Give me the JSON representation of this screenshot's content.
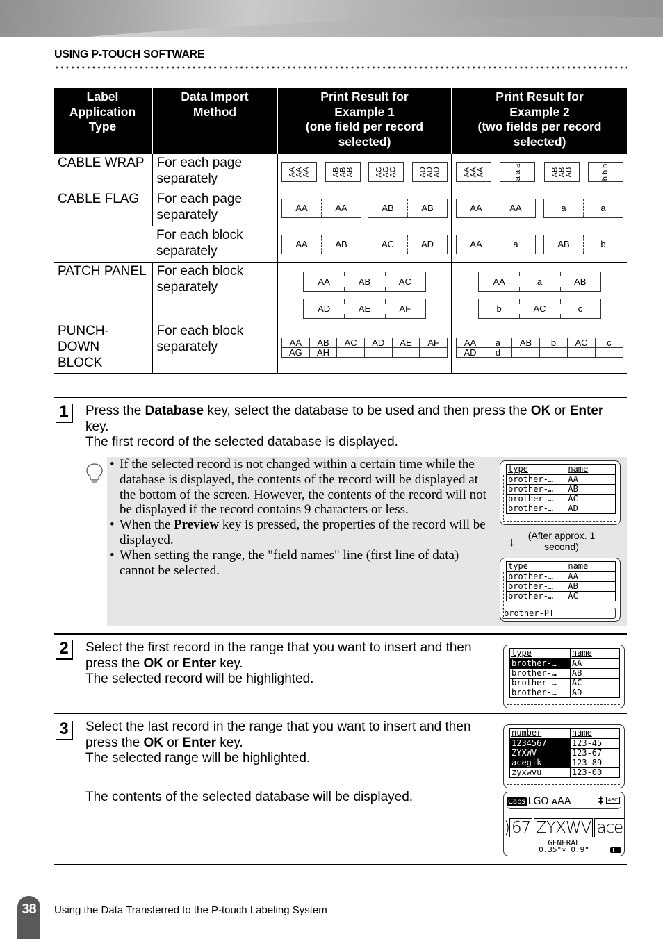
{
  "header": {
    "section_title": "USING P-TOUCH SOFTWARE"
  },
  "table": {
    "headers": [
      "Label Application Type",
      "Data Import Method",
      "Print Result for Example 1 (one field per record selected)",
      "Print Result for Example 2 (two fields per record selected)"
    ],
    "header_lines": [
      [
        "Label",
        "Application",
        "Type"
      ],
      [
        "Data Import",
        "Method"
      ],
      [
        "Print Result for",
        "Example 1",
        "(one field per record",
        "selected)"
      ],
      [
        "Print Result for",
        "Example 2",
        "(two fields per record",
        "selected)"
      ]
    ],
    "rows": {
      "cable_wrap": {
        "type": "CABLE WRAP",
        "method": "For each page separately",
        "ex1": [
          "AA\nAA\nAA",
          "AB\nAB\nAB",
          "AC\nAC\nAC",
          "AD\nAD\nAD"
        ],
        "ex2": [
          "AA\nAA\nAA",
          "a a a",
          "AB\nAB\nAB",
          "b b b"
        ]
      },
      "cable_flag_page": {
        "type": "CABLE FLAG",
        "method": "For each page separately",
        "ex1": [
          [
            "AA",
            "AA"
          ],
          [
            "AB",
            "AB"
          ]
        ],
        "ex2": [
          [
            "AA",
            "AA"
          ],
          [
            "a",
            "a"
          ]
        ]
      },
      "cable_flag_block": {
        "method": "For each block separately",
        "ex1": [
          [
            "AA",
            "AB"
          ],
          [
            "AC",
            "AD"
          ]
        ],
        "ex2": [
          [
            "AA",
            "a"
          ],
          [
            "AB",
            "b"
          ]
        ]
      },
      "patch_panel": {
        "type": "PATCH PANEL",
        "method": "For each block separately",
        "ex1": [
          [
            "AA",
            "AB",
            "AC"
          ],
          [
            "AD",
            "AE",
            "AF"
          ]
        ],
        "ex2": [
          [
            "AA",
            "a",
            "AB"
          ],
          [
            "b",
            "AC",
            "c"
          ]
        ]
      },
      "punch_down": {
        "type": "PUNCH- DOWN BLOCK",
        "type_lines": [
          "PUNCH-",
          "DOWN",
          "BLOCK"
        ],
        "method": "For each block separately",
        "ex1": [
          [
            "AA",
            "AB",
            "AC",
            "AD",
            "AE",
            "AF"
          ],
          [
            "AG",
            "AH",
            "",
            "",
            "",
            ""
          ]
        ],
        "ex2": [
          [
            "AA",
            "a",
            "AB",
            "b",
            "AC",
            "c"
          ],
          [
            "AD",
            "d",
            "",
            "",
            "",
            ""
          ]
        ]
      }
    }
  },
  "steps": [
    {
      "number": "1",
      "parts": [
        {
          "t": "Press the "
        },
        {
          "b": "Database"
        },
        {
          "t": " key, select the database to be used and then press the "
        },
        {
          "b": "OK"
        },
        {
          "t": " or "
        },
        {
          "b": "Enter"
        },
        {
          "t": " key."
        }
      ],
      "line2": "The first record of the selected database is displayed."
    },
    {
      "number": "2",
      "parts": [
        {
          "t": "Select the first record in the range that you want to insert and then press the "
        },
        {
          "b": "OK"
        },
        {
          "t": " or "
        },
        {
          "b": "Enter"
        },
        {
          "t": " key."
        }
      ],
      "line2": "The selected record will be highlighted."
    },
    {
      "number": "3",
      "parts": [
        {
          "t": "Select the last record in the range that you want to insert and then press the "
        },
        {
          "b": "OK"
        },
        {
          "t": " or "
        },
        {
          "b": "Enter"
        },
        {
          "t": " key."
        }
      ],
      "line2": "The selected range will be highlighted.",
      "line3": "The contents of the selected database will be displayed."
    }
  ],
  "hint": {
    "icon": "lightbulb-icon",
    "bullets": [
      [
        {
          "t": "If the selected record is not changed within a certain time while the database is displayed, the contents of the record will be displayed at the bottom of the screen. However, the contents of the record will not be displayed if the record contains 9 characters or less."
        }
      ],
      [
        {
          "t": "When the "
        },
        {
          "b": "Preview"
        },
        {
          "t": " key is pressed, the properties of the record will be displayed."
        }
      ],
      [
        {
          "t": "When setting the range, the \"field names\" line (first line of data) cannot be selected."
        }
      ]
    ],
    "after_note": "(After approx. 1 second)",
    "arrow": "↓"
  },
  "screens": {
    "db1": {
      "header": [
        "type",
        "name"
      ],
      "rows": [
        [
          "brother-…",
          "AA"
        ],
        [
          "brother-…",
          "AB"
        ],
        [
          "brother-…",
          "AC"
        ],
        [
          "brother-…",
          "AD"
        ]
      ]
    },
    "db2": {
      "header": [
        "type",
        "name"
      ],
      "rows": [
        [
          "brother-…",
          "AA"
        ],
        [
          "brother-…",
          "AB"
        ],
        [
          "brother-…",
          "AC"
        ]
      ],
      "bottom": "brother-PT"
    },
    "db3": {
      "header": [
        "type",
        "name"
      ],
      "rows": [
        [
          "brother-…",
          "AA"
        ],
        [
          "brother-…",
          "AB"
        ],
        [
          "brother-…",
          "AC"
        ],
        [
          "brother-…",
          "AD"
        ]
      ],
      "selected_rows": [
        0
      ]
    },
    "db4": {
      "header": [
        "number",
        "name"
      ],
      "rows": [
        [
          "1234567",
          "123-45"
        ],
        [
          "ZYXWV",
          "123-67"
        ],
        [
          "acegik",
          "123-89"
        ],
        [
          "zyxwvu",
          "123-00"
        ]
      ],
      "selected_rows": [
        0,
        1,
        2
      ]
    },
    "edit": {
      "caps": "Caps",
      "status": "LGO ᴀAA",
      "align_icon": "‡",
      "abc": "ABC",
      "blocks": [
        "67",
        "ZYXWV",
        "acegik"
      ],
      "prefix": ")",
      "format": "GENERAL",
      "size": "0.35\"× 0.9\""
    }
  },
  "footer": {
    "page_number": "38",
    "text": "Using the Data Transferred to the P-touch Labeling System"
  }
}
